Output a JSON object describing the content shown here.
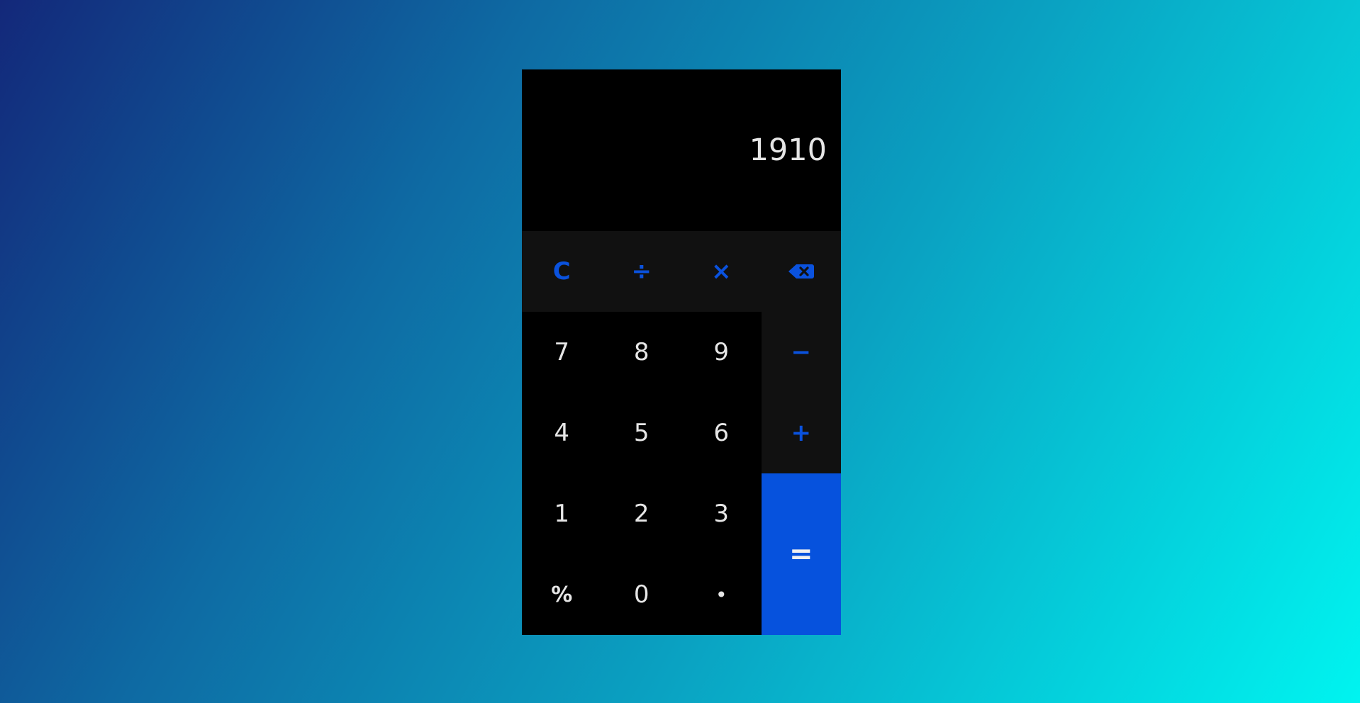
{
  "display": {
    "value": "1910"
  },
  "keys": {
    "clear": "C",
    "divide": "÷",
    "multiply": "×",
    "backspace_icon": "backspace-icon",
    "minus": "−",
    "plus": "+",
    "equals": "=",
    "d7": "7",
    "d8": "8",
    "d9": "9",
    "d4": "4",
    "d5": "5",
    "d6": "6",
    "d1": "1",
    "d2": "2",
    "d3": "3",
    "percent": "%",
    "d0": "0",
    "decimal": "•"
  },
  "colors": {
    "accent": "#0652dd",
    "operator_bg": "#111111",
    "digit_bg": "#000000",
    "text": "#e6e6e6",
    "gradient_start": "#13287a",
    "gradient_end": "#00f4f0"
  }
}
